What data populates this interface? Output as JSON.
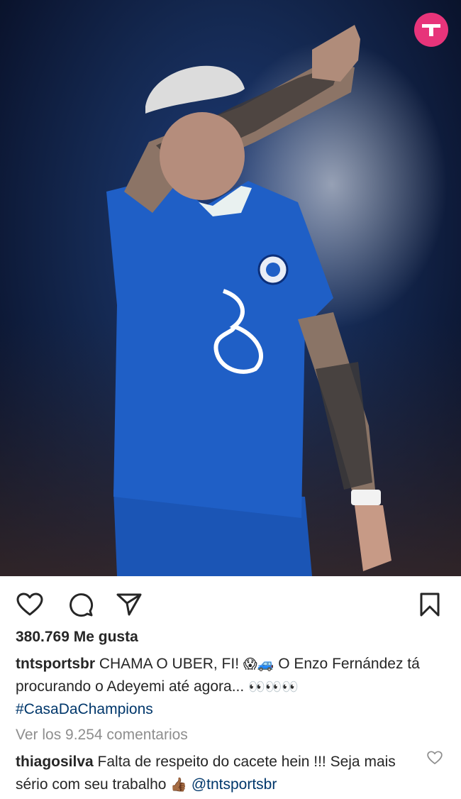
{
  "post": {
    "image_alt": "Football player in blue Chelsea kit covering his face with tattooed arm",
    "brand_logo": "tnt-sports-logo"
  },
  "actions": {
    "like_icon": "heart-icon",
    "comment_icon": "comment-icon",
    "share_icon": "send-icon",
    "save_icon": "bookmark-icon"
  },
  "likes_text": "380.769 Me gusta",
  "caption": {
    "username": "tntsportsbr",
    "text_part1": "CHAMA O UBER, FI!",
    "emoji1": "😱🚙",
    "text_part2": "O Enzo Fernández tá procurando o Adeyemi até agora...",
    "emoji2": "👀👀👀",
    "hashtag": "#CasaDaChampions"
  },
  "view_comments": "Ver los 9.254 comentarios",
  "comment": {
    "username": "thiagosilva",
    "text": "Falta de respeito do cacete hein !!! Seja mais sério com seu trabalho",
    "emoji": "👍🏾",
    "mention": "@tntsportsbr"
  },
  "colors": {
    "brand": "#e7347a",
    "link": "#00376b",
    "muted": "#8e8e8e",
    "text": "#262626"
  }
}
